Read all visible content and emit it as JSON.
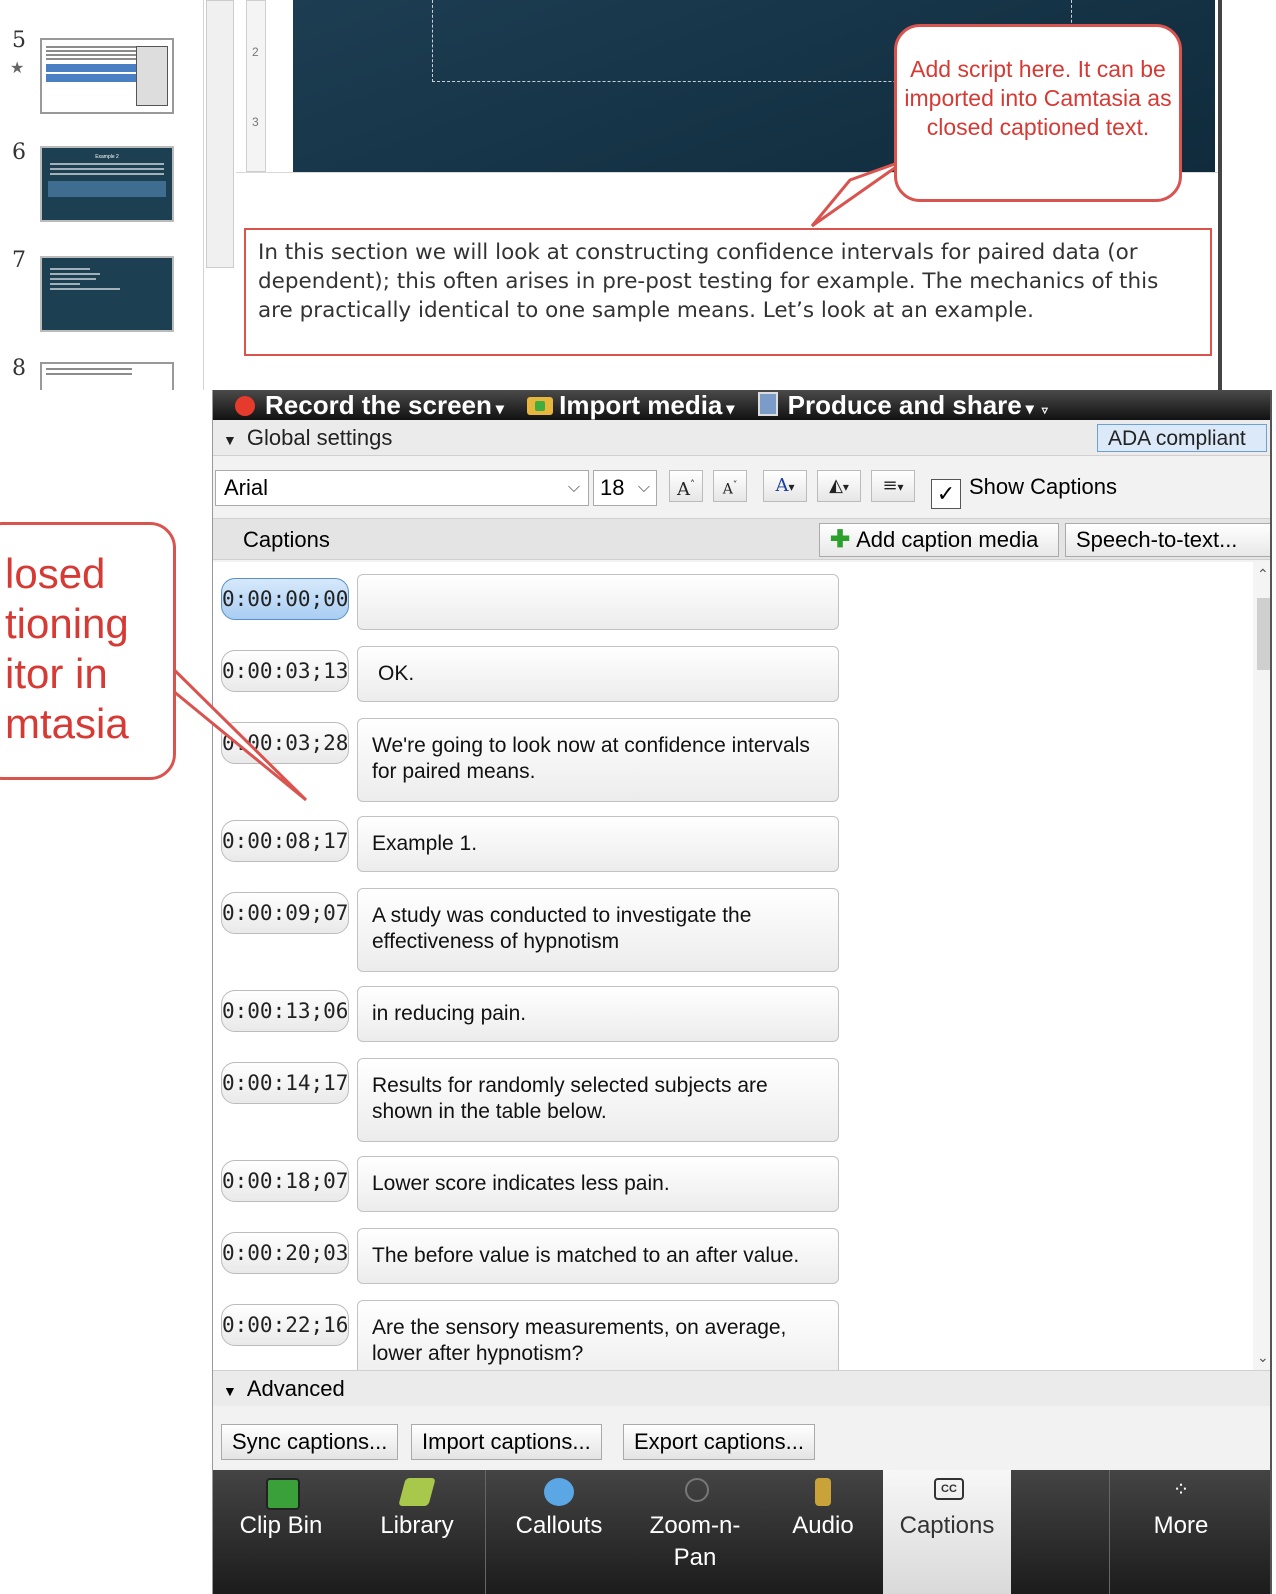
{
  "powerpoint": {
    "slides": [
      {
        "num": "5",
        "star": "★",
        "title": ""
      },
      {
        "num": "6",
        "title": "Example 2"
      },
      {
        "num": "7",
        "title": ""
      },
      {
        "num": "8",
        "title": ""
      }
    ],
    "ruler_marks": [
      "2",
      "3"
    ],
    "notes_text": "In this section we will look at constructing confidence intervals for paired data (or dependent); this often arises in pre-post testing for example.  The mechanics of this are practically identical to one sample means.  Let’s look at an example."
  },
  "callouts": {
    "script": "Add script here. It can be imported into Camtasia as closed captioned text.",
    "editor": "losed\ntioning\nitor in\nmtasia"
  },
  "toolbar": {
    "record": "Record the screen",
    "import": "Import media",
    "produce": "Produce and share"
  },
  "global_settings": {
    "label": "Global settings",
    "ada": "ADA compliant",
    "font": "Arial",
    "size": "18",
    "show_captions": "Show Captions"
  },
  "captions_header": {
    "label": "Captions",
    "add_media": "Add caption media",
    "speech_to_text": "Speech-to-text..."
  },
  "captions": [
    {
      "time": "0:00:00;00",
      "text": ""
    },
    {
      "time": "0:00:03;13",
      "text": "OK."
    },
    {
      "time": "0:00:03;28",
      "text": "We're going to look now at confidence intervals for paired means."
    },
    {
      "time": "0:00:08;17",
      "text": "Example 1."
    },
    {
      "time": "0:00:09;07",
      "text": "A study was conducted to investigate the effectiveness of hypnotism"
    },
    {
      "time": "0:00:13;06",
      "text": "in reducing pain."
    },
    {
      "time": "0:00:14;17",
      "text": "Results for randomly selected subjects are shown in the table below."
    },
    {
      "time": "0:00:18;07",
      "text": "Lower score indicates less pain."
    },
    {
      "time": "0:00:20;03",
      "text": "The before value is matched to an after value."
    },
    {
      "time": "0:00:22;16",
      "text": "Are the sensory measurements, on average, lower after hypnotism?"
    }
  ],
  "advanced": {
    "label": "Advanced",
    "sync": "Sync captions...",
    "import": "Import captions...",
    "export": "Export captions..."
  },
  "tabs": {
    "clip_bin": "Clip Bin",
    "library": "Library",
    "callouts": "Callouts",
    "zoom": "Zoom-n-\nPan",
    "audio": "Audio",
    "captions": "Captions",
    "more": "More"
  }
}
